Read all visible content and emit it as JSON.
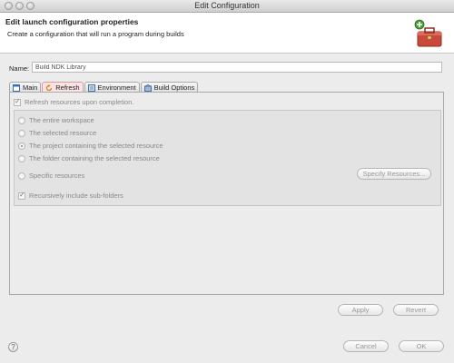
{
  "window": {
    "title": "Edit Configuration"
  },
  "header": {
    "title": "Edit launch configuration properties",
    "description": "Create a configuration that will run a program during builds",
    "icon": "toolbox-icon"
  },
  "name": {
    "label": "Name:",
    "value": "Build NDK Library"
  },
  "tabs": [
    {
      "label": "Main",
      "icon": "main-tab-icon",
      "active": false
    },
    {
      "label": "Refresh",
      "icon": "refresh-tab-icon",
      "active": true
    },
    {
      "label": "Environment",
      "icon": "environment-tab-icon",
      "active": false
    },
    {
      "label": "Build Options",
      "icon": "build-options-tab-icon",
      "active": false
    }
  ],
  "refresh": {
    "refresh_label": "Refresh resources upon completion.",
    "options": [
      {
        "label": "The entire workspace",
        "selected": false
      },
      {
        "label": "The selected resource",
        "selected": false
      },
      {
        "label": "The project containing the selected resource",
        "selected": true
      },
      {
        "label": "The folder containing the selected resource",
        "selected": false
      },
      {
        "label": "Specific resources",
        "selected": false
      }
    ],
    "specify_button": "Specify Resources...",
    "recursive_label": "Recursively include sub-folders"
  },
  "panel_buttons": {
    "apply": "Apply",
    "revert": "Revert"
  },
  "dialog_buttons": {
    "cancel": "Cancel",
    "ok": "OK",
    "help": "?"
  }
}
